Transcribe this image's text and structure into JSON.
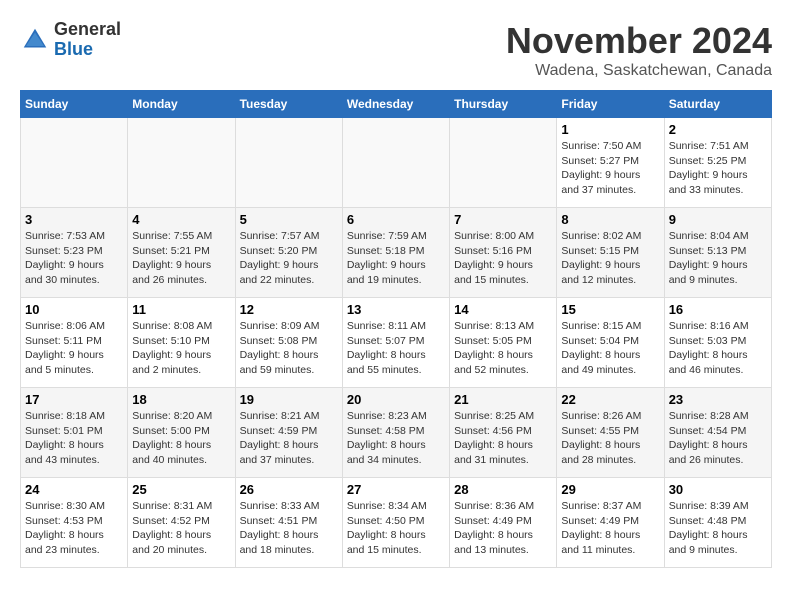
{
  "header": {
    "logo_line1": "General",
    "logo_line2": "Blue",
    "month": "November 2024",
    "location": "Wadena, Saskatchewan, Canada"
  },
  "days_of_week": [
    "Sunday",
    "Monday",
    "Tuesday",
    "Wednesday",
    "Thursday",
    "Friday",
    "Saturday"
  ],
  "weeks": [
    [
      {
        "day": "",
        "info": ""
      },
      {
        "day": "",
        "info": ""
      },
      {
        "day": "",
        "info": ""
      },
      {
        "day": "",
        "info": ""
      },
      {
        "day": "",
        "info": ""
      },
      {
        "day": "1",
        "info": "Sunrise: 7:50 AM\nSunset: 5:27 PM\nDaylight: 9 hours\nand 37 minutes."
      },
      {
        "day": "2",
        "info": "Sunrise: 7:51 AM\nSunset: 5:25 PM\nDaylight: 9 hours\nand 33 minutes."
      }
    ],
    [
      {
        "day": "3",
        "info": "Sunrise: 7:53 AM\nSunset: 5:23 PM\nDaylight: 9 hours\nand 30 minutes."
      },
      {
        "day": "4",
        "info": "Sunrise: 7:55 AM\nSunset: 5:21 PM\nDaylight: 9 hours\nand 26 minutes."
      },
      {
        "day": "5",
        "info": "Sunrise: 7:57 AM\nSunset: 5:20 PM\nDaylight: 9 hours\nand 22 minutes."
      },
      {
        "day": "6",
        "info": "Sunrise: 7:59 AM\nSunset: 5:18 PM\nDaylight: 9 hours\nand 19 minutes."
      },
      {
        "day": "7",
        "info": "Sunrise: 8:00 AM\nSunset: 5:16 PM\nDaylight: 9 hours\nand 15 minutes."
      },
      {
        "day": "8",
        "info": "Sunrise: 8:02 AM\nSunset: 5:15 PM\nDaylight: 9 hours\nand 12 minutes."
      },
      {
        "day": "9",
        "info": "Sunrise: 8:04 AM\nSunset: 5:13 PM\nDaylight: 9 hours\nand 9 minutes."
      }
    ],
    [
      {
        "day": "10",
        "info": "Sunrise: 8:06 AM\nSunset: 5:11 PM\nDaylight: 9 hours\nand 5 minutes."
      },
      {
        "day": "11",
        "info": "Sunrise: 8:08 AM\nSunset: 5:10 PM\nDaylight: 9 hours\nand 2 minutes."
      },
      {
        "day": "12",
        "info": "Sunrise: 8:09 AM\nSunset: 5:08 PM\nDaylight: 8 hours\nand 59 minutes."
      },
      {
        "day": "13",
        "info": "Sunrise: 8:11 AM\nSunset: 5:07 PM\nDaylight: 8 hours\nand 55 minutes."
      },
      {
        "day": "14",
        "info": "Sunrise: 8:13 AM\nSunset: 5:05 PM\nDaylight: 8 hours\nand 52 minutes."
      },
      {
        "day": "15",
        "info": "Sunrise: 8:15 AM\nSunset: 5:04 PM\nDaylight: 8 hours\nand 49 minutes."
      },
      {
        "day": "16",
        "info": "Sunrise: 8:16 AM\nSunset: 5:03 PM\nDaylight: 8 hours\nand 46 minutes."
      }
    ],
    [
      {
        "day": "17",
        "info": "Sunrise: 8:18 AM\nSunset: 5:01 PM\nDaylight: 8 hours\nand 43 minutes."
      },
      {
        "day": "18",
        "info": "Sunrise: 8:20 AM\nSunset: 5:00 PM\nDaylight: 8 hours\nand 40 minutes."
      },
      {
        "day": "19",
        "info": "Sunrise: 8:21 AM\nSunset: 4:59 PM\nDaylight: 8 hours\nand 37 minutes."
      },
      {
        "day": "20",
        "info": "Sunrise: 8:23 AM\nSunset: 4:58 PM\nDaylight: 8 hours\nand 34 minutes."
      },
      {
        "day": "21",
        "info": "Sunrise: 8:25 AM\nSunset: 4:56 PM\nDaylight: 8 hours\nand 31 minutes."
      },
      {
        "day": "22",
        "info": "Sunrise: 8:26 AM\nSunset: 4:55 PM\nDaylight: 8 hours\nand 28 minutes."
      },
      {
        "day": "23",
        "info": "Sunrise: 8:28 AM\nSunset: 4:54 PM\nDaylight: 8 hours\nand 26 minutes."
      }
    ],
    [
      {
        "day": "24",
        "info": "Sunrise: 8:30 AM\nSunset: 4:53 PM\nDaylight: 8 hours\nand 23 minutes."
      },
      {
        "day": "25",
        "info": "Sunrise: 8:31 AM\nSunset: 4:52 PM\nDaylight: 8 hours\nand 20 minutes."
      },
      {
        "day": "26",
        "info": "Sunrise: 8:33 AM\nSunset: 4:51 PM\nDaylight: 8 hours\nand 18 minutes."
      },
      {
        "day": "27",
        "info": "Sunrise: 8:34 AM\nSunset: 4:50 PM\nDaylight: 8 hours\nand 15 minutes."
      },
      {
        "day": "28",
        "info": "Sunrise: 8:36 AM\nSunset: 4:49 PM\nDaylight: 8 hours\nand 13 minutes."
      },
      {
        "day": "29",
        "info": "Sunrise: 8:37 AM\nSunset: 4:49 PM\nDaylight: 8 hours\nand 11 minutes."
      },
      {
        "day": "30",
        "info": "Sunrise: 8:39 AM\nSunset: 4:48 PM\nDaylight: 8 hours\nand 9 minutes."
      }
    ]
  ]
}
